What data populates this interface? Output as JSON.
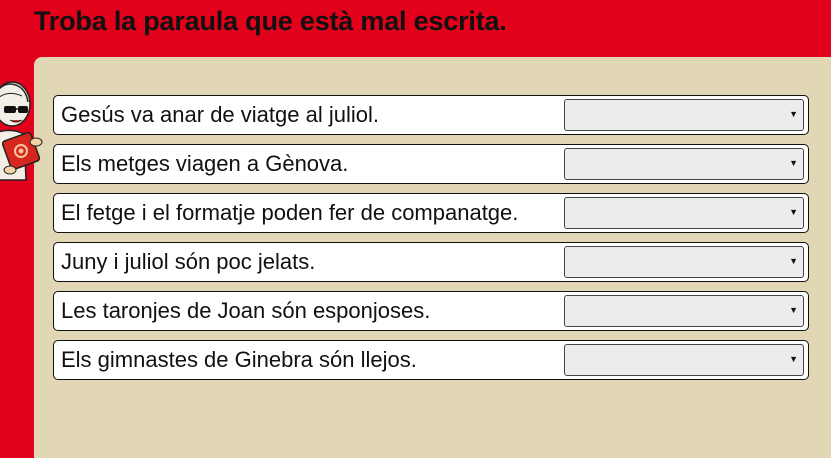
{
  "header": {
    "title": "Troba la paraula que està mal escrita."
  },
  "exercise": {
    "rows": [
      {
        "sentence": "Gesús va anar de viatge al juliol.",
        "selected": ""
      },
      {
        "sentence": "Els metges viagen a Gènova.",
        "selected": ""
      },
      {
        "sentence": "El fetge i el formatje poden fer de companatge.",
        "selected": ""
      },
      {
        "sentence": "Juny i juliol són poc jelats.",
        "selected": ""
      },
      {
        "sentence": "Les taronjes de Joan són esponjoses.",
        "selected": ""
      },
      {
        "sentence": "Els gimnastes de Ginebra són llejos.",
        "selected": ""
      }
    ],
    "dropdown_icon": "triangle-down-icon"
  },
  "colors": {
    "background": "#e2001a",
    "panel": "#e2d7b5"
  }
}
